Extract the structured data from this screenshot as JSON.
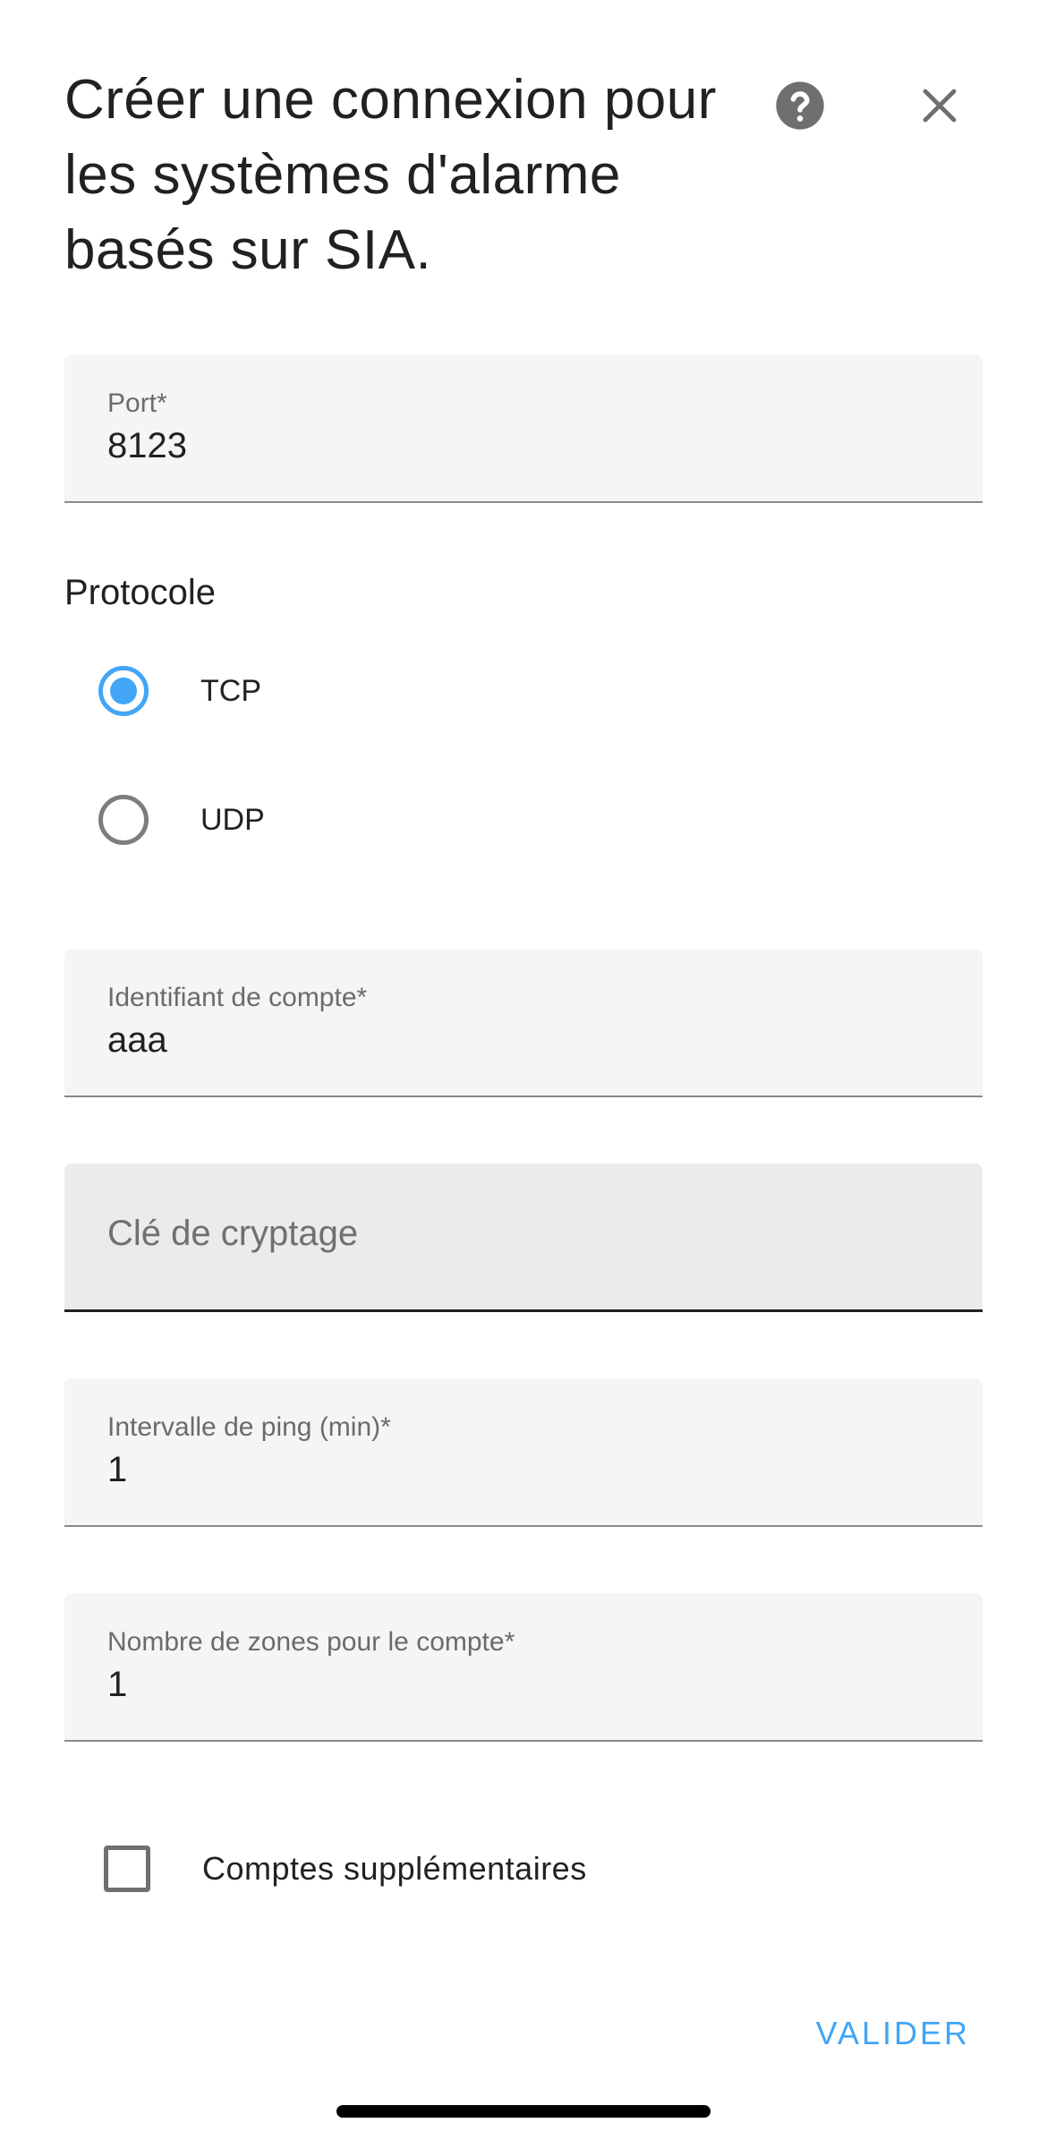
{
  "dialog": {
    "title": "Créer une connexion pour les systèmes d'alarme basés sur SIA."
  },
  "icons": {
    "help": "help-circle-icon",
    "close": "close-icon"
  },
  "fields": {
    "port": {
      "label": "Port*",
      "value": "8123"
    },
    "account_id": {
      "label": "Identifiant de compte*",
      "value": "aaa"
    },
    "encryption_key": {
      "placeholder": "Clé de cryptage",
      "value": ""
    },
    "ping_interval": {
      "label": "Intervalle de ping (min)*",
      "value": "1"
    },
    "zones": {
      "label": "Nombre de zones pour le compte*",
      "value": "1"
    }
  },
  "protocol": {
    "label": "Protocole",
    "options": [
      {
        "label": "TCP",
        "selected": true
      },
      {
        "label": "UDP",
        "selected": false
      }
    ]
  },
  "additional_accounts": {
    "label": "Comptes supplémentaires",
    "checked": false
  },
  "actions": {
    "submit_label": "VALIDER"
  },
  "colors": {
    "accent": "#42a5f5",
    "text": "#212121",
    "field_bg": "#f5f5f5"
  }
}
